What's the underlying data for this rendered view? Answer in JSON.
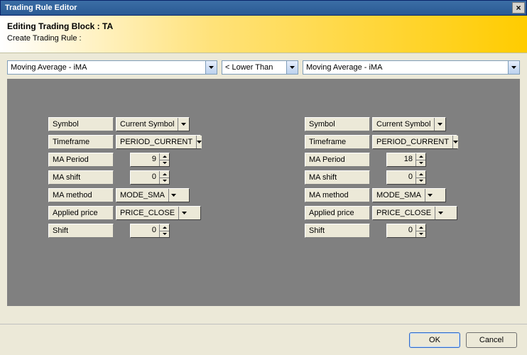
{
  "window": {
    "title": "Trading Rule Editor",
    "close_icon": "×"
  },
  "header": {
    "title": "Editing Trading Block : TA",
    "subtitle": "Create Trading Rule :"
  },
  "selectors": {
    "left": "Moving Average - iMA",
    "operator": "< Lower Than",
    "right": "Moving Average - iMA"
  },
  "params": {
    "labels": {
      "symbol": "Symbol",
      "timeframe": "Timeframe",
      "ma_period": "MA Period",
      "ma_shift": "MA shift",
      "ma_method": "MA method",
      "applied_price": "Applied price",
      "shift": "Shift"
    },
    "left": {
      "symbol": "Current Symbol",
      "timeframe": "PERIOD_CURRENT",
      "ma_period": "9",
      "ma_shift": "0",
      "ma_method": "MODE_SMA",
      "applied_price": "PRICE_CLOSE",
      "shift": "0"
    },
    "right": {
      "symbol": "Current Symbol",
      "timeframe": "PERIOD_CURRENT",
      "ma_period": "18",
      "ma_shift": "0",
      "ma_method": "MODE_SMA",
      "applied_price": "PRICE_CLOSE",
      "shift": "0"
    }
  },
  "footer": {
    "ok": "OK",
    "cancel": "Cancel"
  }
}
